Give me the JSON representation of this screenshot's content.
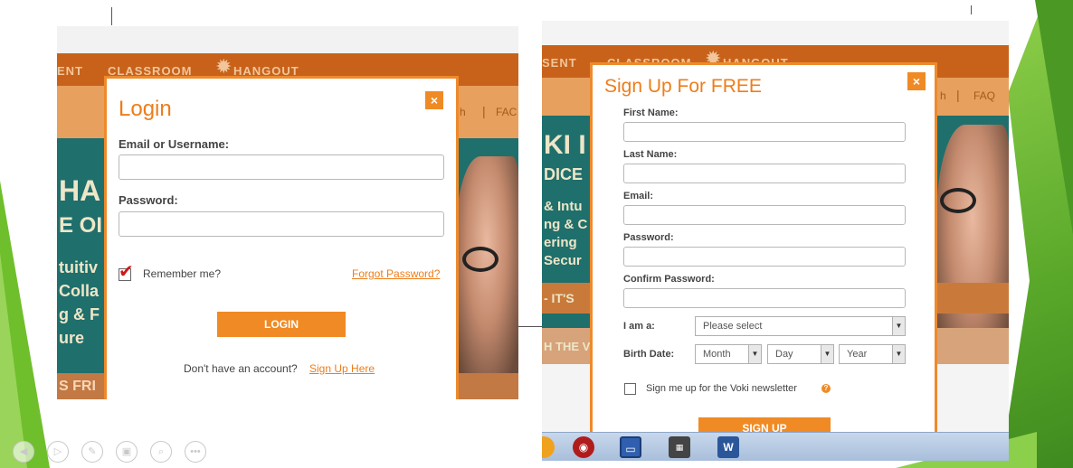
{
  "colors": {
    "accent": "#ee7d1a",
    "nav_orange": "#c8621b",
    "teal": "#1f6f6c",
    "slide_green": "#6fbf2c"
  },
  "login_bg": {
    "nav_left": "ENT",
    "nav_mid": "CLASSROOM",
    "nav_logo": "HANGOUT",
    "sub_right": "h",
    "faq": "FAC",
    "hero_lines": [
      "HA",
      "E OI",
      "tuitiv",
      "Colla",
      "g & F",
      "ure"
    ],
    "bottom_left": "S FRI"
  },
  "login": {
    "title": "Login",
    "close_label": "×",
    "email_label": "Email or Username:",
    "email_value": "",
    "password_label": "Password:",
    "password_value": "",
    "remember_label": "Remember me?",
    "remember_checked": true,
    "forgot_link": "Forgot Password?",
    "login_button": "LOGIN",
    "no_account_text": "Don't have an account?",
    "signup_link": "Sign Up Here"
  },
  "signup_bg": {
    "nav_left": "SENT",
    "nav_mid": "CLASSROOM",
    "nav_logo": "HANGOUT",
    "sub_right": "h",
    "faq": "FAQ",
    "hero_lines": [
      "KI I",
      "DICE",
      "& Intu",
      "ng & C",
      "ering",
      "Secur",
      "- IT'S",
      "H THE V"
    ]
  },
  "signup": {
    "title": "Sign Up For FREE",
    "close_label": "×",
    "first_name_label": "First Name:",
    "last_name_label": "Last Name:",
    "email_label": "Email:",
    "password_label": "Password:",
    "confirm_password_label": "Confirm Password:",
    "i_am_label": "I am a:",
    "i_am_select": "Please select",
    "birth_date_label": "Birth Date:",
    "month_select": "Month",
    "day_select": "Day",
    "year_select": "Year",
    "newsletter_label": "Sign me up for the Voki newsletter",
    "newsletter_checked": false,
    "signup_button": "SIGN UP"
  },
  "taskbar": {
    "icons": [
      "word-icon",
      "calculator-icon",
      "save-disk-icon",
      "recorder-icon",
      "chrome-icon"
    ]
  },
  "slide_controls": {
    "icons": [
      "previous-icon",
      "play-icon",
      "pen-icon",
      "slides-icon",
      "zoom-icon",
      "more-icon"
    ],
    "more_label": "•••"
  }
}
